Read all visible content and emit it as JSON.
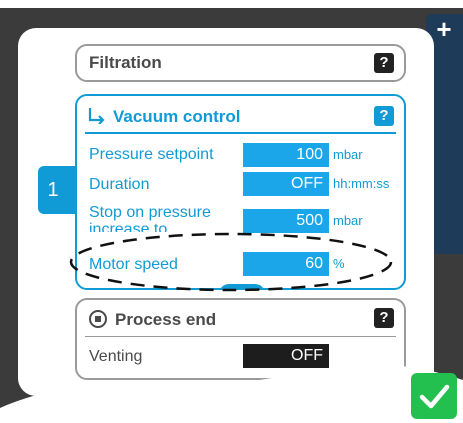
{
  "side_panel": {
    "add_glyph": "+"
  },
  "step_tab": {
    "number": "1"
  },
  "filtration": {
    "title": "Filtration",
    "help": "?"
  },
  "vacuum_control": {
    "title": "Vacuum control",
    "help": "?",
    "icon": "vacuum-arrow-icon",
    "rows": [
      {
        "label": "Pressure setpoint",
        "value": "100",
        "unit": "mbar"
      },
      {
        "label": "Duration",
        "value": "OFF",
        "unit": "hh:mm:ss"
      },
      {
        "label": "Stop on pressure increase to",
        "value": "500",
        "unit": "mbar"
      },
      {
        "label": "Motor speed",
        "value": "60",
        "unit": "%"
      }
    ]
  },
  "process_end": {
    "title": "Process end",
    "help": "?",
    "icon": "stop-circle-icon",
    "venting_label": "Venting",
    "venting_value": "OFF"
  },
  "colors": {
    "accent": "#119bd6",
    "field": "#1aa6e8",
    "confirm": "#23c04f",
    "dark": "#1d1d1d"
  },
  "confirm": {
    "icon": "checkmark-icon"
  }
}
